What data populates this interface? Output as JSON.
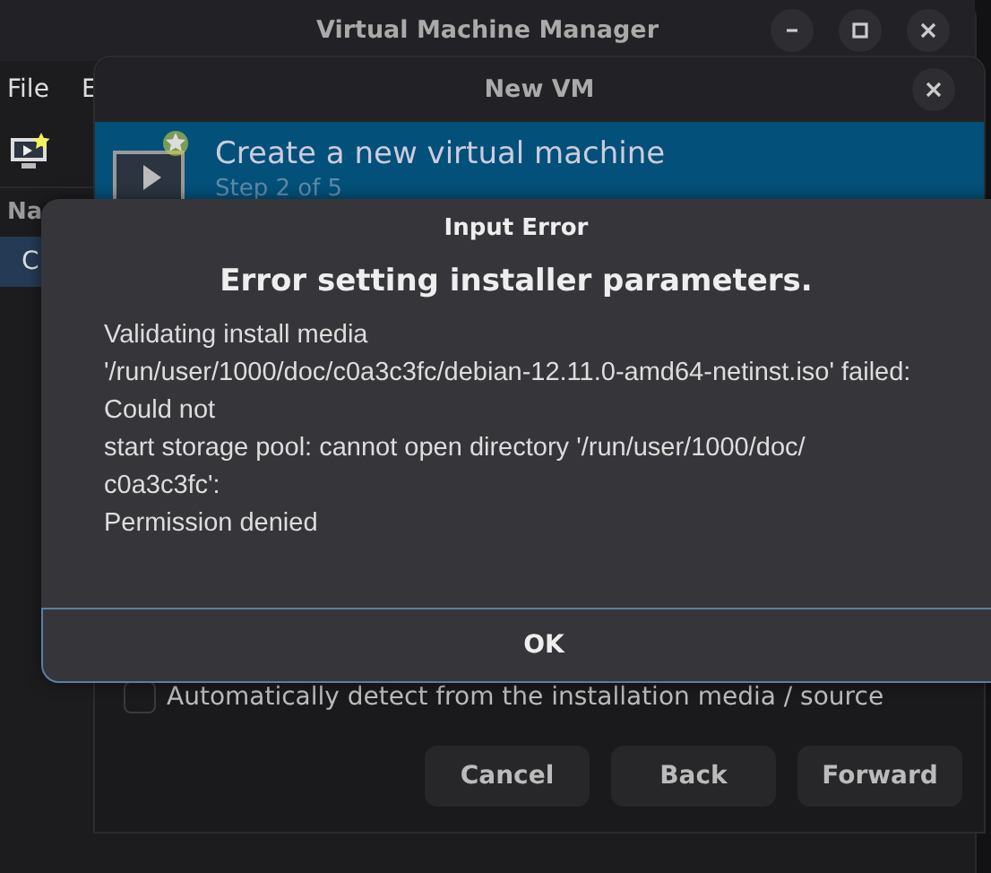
{
  "main_window": {
    "title": "Virtual Machine Manager",
    "menu": [
      "File",
      "E"
    ],
    "list_header": "Na",
    "rows": [
      {
        "label": "C",
        "selected": true
      }
    ]
  },
  "new_vm": {
    "title": "New VM",
    "banner_title": "Create a new virtual machine",
    "banner_subtitle": "Step 2 of 5",
    "checkbox": {
      "label": "Automatically detect from the installation media / source",
      "checked": false
    },
    "buttons": [
      "Cancel",
      "Back",
      "Forward"
    ]
  },
  "error_dialog": {
    "title": "Input Error",
    "heading": "Error setting installer parameters.",
    "message": "Validating install media\n'/run/user/1000/doc/c0a3c3fc/debian-12.11.0-amd64-netinst.iso' failed:\nCould not\nstart storage pool: cannot open directory '/run/user/1000/doc/\nc0a3c3fc':\nPermission denied",
    "button": "OK"
  }
}
